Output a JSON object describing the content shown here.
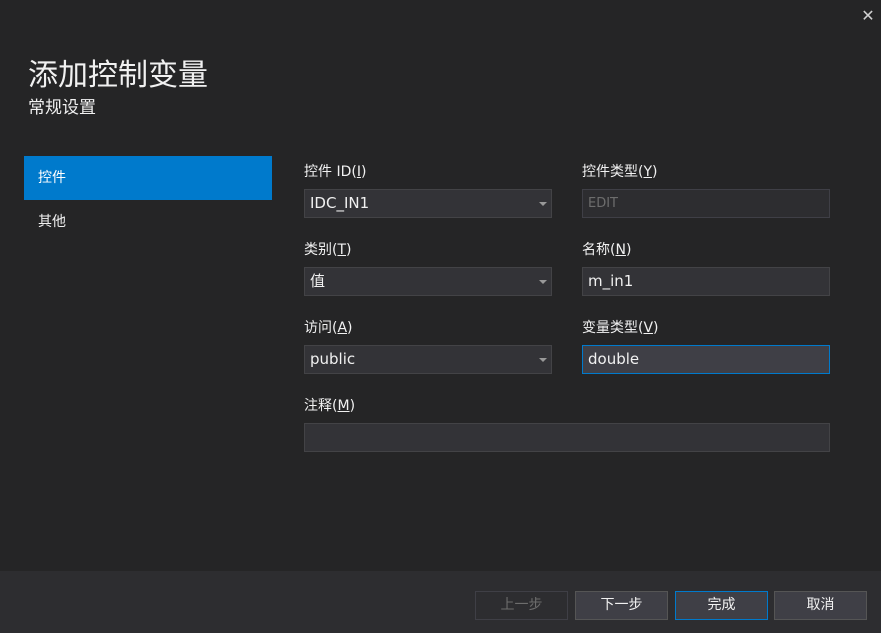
{
  "dialog": {
    "title": "添加控制变量",
    "subtitle": "常规设置",
    "close_glyph": "✕"
  },
  "nav": {
    "items": [
      {
        "label": "控件",
        "active": true
      },
      {
        "label": "其他",
        "active": false
      }
    ]
  },
  "form": {
    "control_id": {
      "label_text": "控件 ID(",
      "label_key": "I",
      "label_end": ")",
      "value": "IDC_IN1"
    },
    "control_type": {
      "label_text": "控件类型(",
      "label_key": "Y",
      "label_end": ")",
      "value": "EDIT"
    },
    "category": {
      "label_text": "类别(",
      "label_key": "T",
      "label_end": ")",
      "value": "值"
    },
    "name": {
      "label_text": "名称(",
      "label_key": "N",
      "label_end": ")",
      "value": "m_in1"
    },
    "access": {
      "label_text": "访问(",
      "label_key": "A",
      "label_end": ")",
      "value": "public"
    },
    "var_type": {
      "label_text": "变量类型(",
      "label_key": "V",
      "label_end": ")",
      "value": "double"
    },
    "comment": {
      "label_text": "注释(",
      "label_key": "M",
      "label_end": ")",
      "value": ""
    }
  },
  "footer": {
    "prev_label": "上一步",
    "next_label": "下一步",
    "finish_label": "完成",
    "cancel_label": "取消"
  },
  "colors": {
    "background": "#252526",
    "accent": "#007acc",
    "footer": "#2d2d30"
  }
}
